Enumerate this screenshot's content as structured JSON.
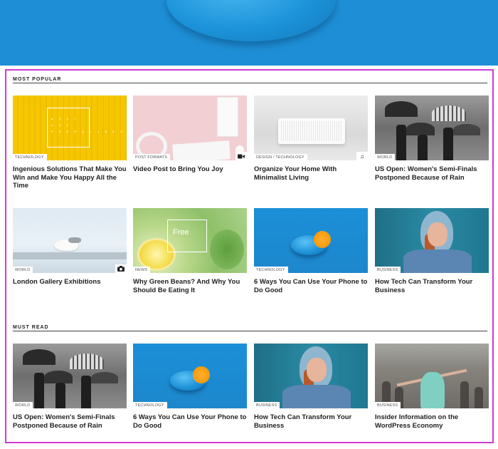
{
  "sections": {
    "most_popular": "MOST POPULAR",
    "must_read": "MUST READ"
  },
  "most_popular": [
    {
      "category": "TECHNOLOGY",
      "title": "Ingenious Solutions That Make You Win and Make You Happy All the Time",
      "thumb_text": "W H A T\nA R E\nP E R M A L I N K S"
    },
    {
      "category": "POST FORMATS",
      "title": "Video Post to Bring You Joy",
      "format_icon": "video-camera-icon"
    },
    {
      "category": "DESIGN / TECHNOLOGY",
      "title": "Organize Your Home With Minimalist Living",
      "format_icon": "music-note-icon"
    },
    {
      "category": "WORLD",
      "title": "US Open: Women's Semi-Finals Postponed Because of Rain"
    },
    {
      "category": "WORLD",
      "title": "London Gallery Exhibitions",
      "format_icon": "camera-icon"
    },
    {
      "category": "NEWS",
      "title": "Why Green Beans? And Why You Should Be Eating It",
      "thumb_text": "Free"
    },
    {
      "category": "TECHNOLOGY",
      "title": "6 Ways You Can Use Your Phone to Do Good"
    },
    {
      "category": "BUSINESS",
      "title": "How Tech Can Transform Your Business"
    }
  ],
  "must_read": [
    {
      "category": "WORLD",
      "title": "US Open: Women's Semi-Finals Postponed Because of Rain"
    },
    {
      "category": "TECHNOLOGY",
      "title": "6 Ways You Can Use Your Phone to Do Good"
    },
    {
      "category": "BUSINESS",
      "title": "How Tech Can Transform Your Business"
    },
    {
      "category": "BUSINESS",
      "title": "Insider Information on the WordPress Economy"
    }
  ],
  "colors": {
    "highlight_frame": "#d13ad1",
    "hero_blue": "#1e8fd6"
  }
}
